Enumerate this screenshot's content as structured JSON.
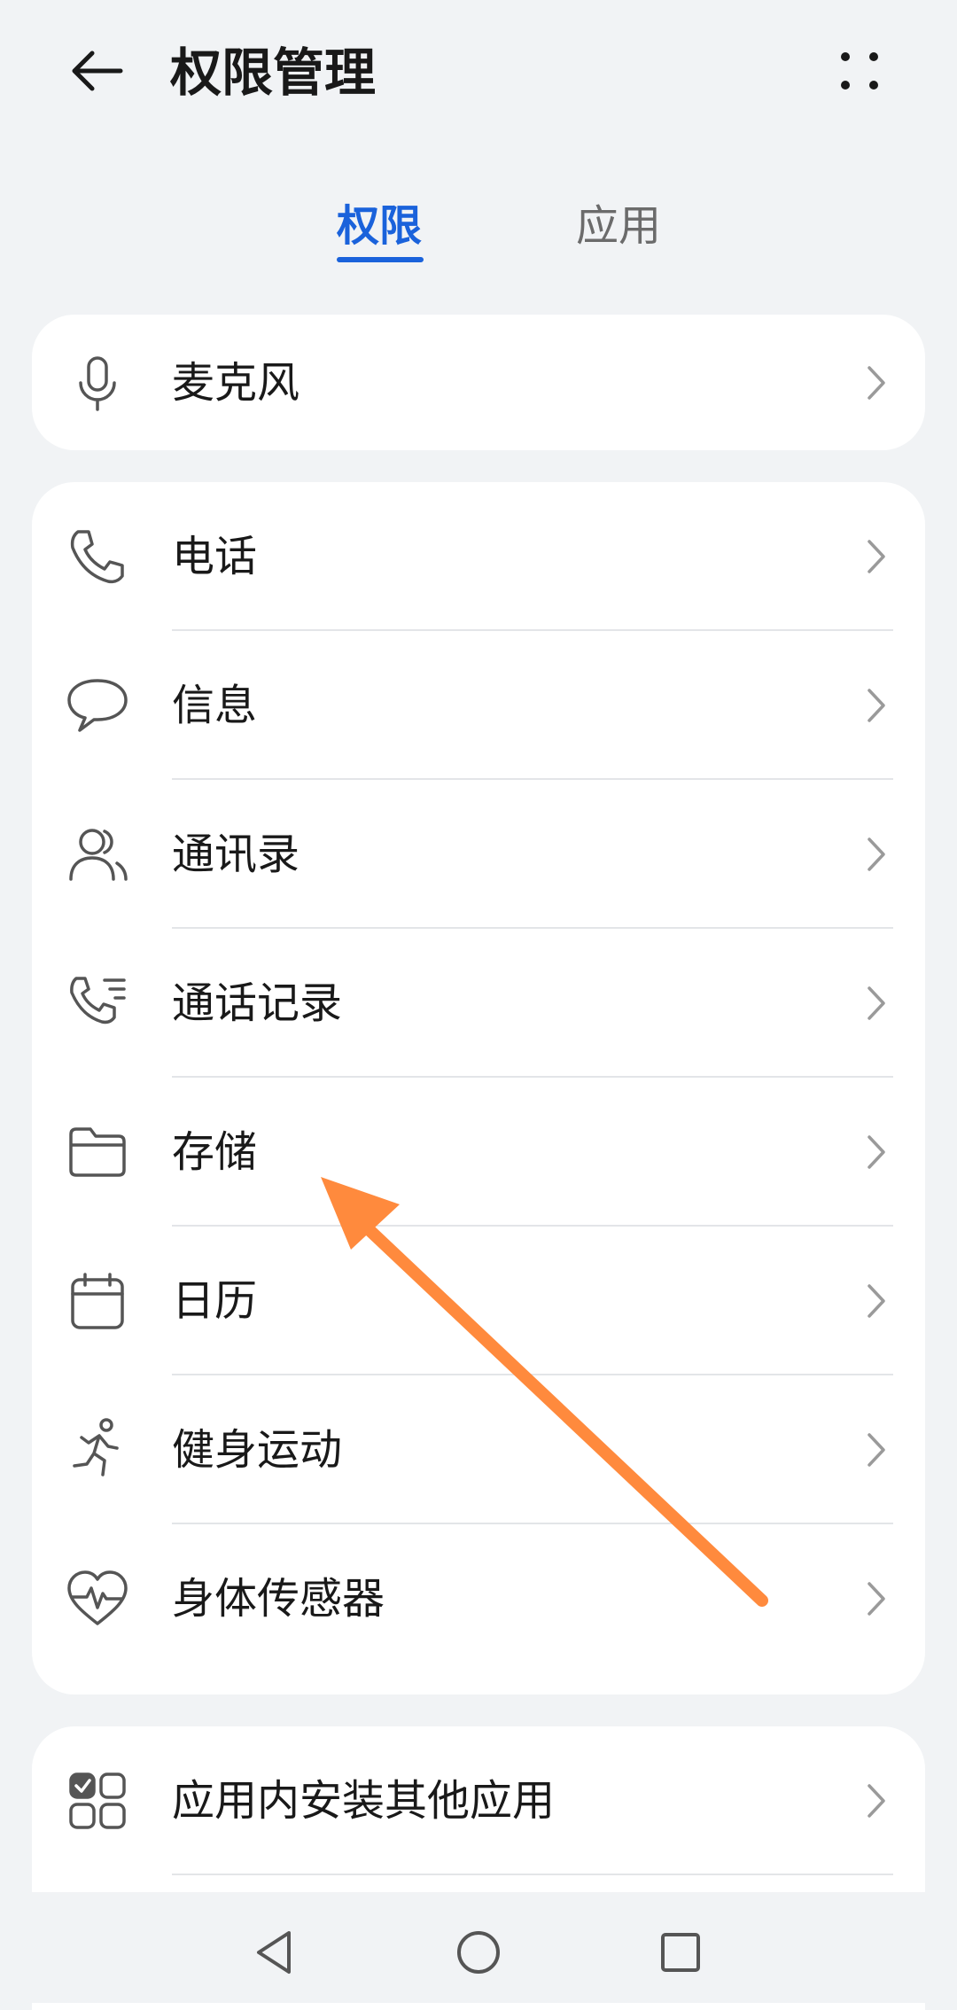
{
  "header": {
    "title": "权限管理",
    "back_icon": "back-arrow-icon",
    "more_icon": "more-dots-icon"
  },
  "tabs": [
    {
      "label": "权限",
      "active": true
    },
    {
      "label": "应用",
      "active": false
    }
  ],
  "colors": {
    "accent": "#1a62db",
    "background": "#f1f3f5",
    "card": "#ffffff",
    "annotation": "#ff8a3d"
  },
  "cards": {
    "first": [
      {
        "label": "麦克风",
        "icon": "microphone-icon"
      }
    ],
    "main": [
      {
        "label": "电话",
        "icon": "phone-icon"
      },
      {
        "label": "信息",
        "icon": "message-icon"
      },
      {
        "label": "通讯录",
        "icon": "contacts-icon"
      },
      {
        "label": "通话记录",
        "icon": "call-log-icon"
      },
      {
        "label": "存储",
        "icon": "folder-icon"
      },
      {
        "label": "日历",
        "icon": "calendar-icon"
      },
      {
        "label": "健身运动",
        "icon": "running-icon"
      },
      {
        "label": "身体传感器",
        "icon": "heart-rate-icon"
      }
    ],
    "last": [
      {
        "label": "应用内安装其他应用",
        "icon": "app-install-icon"
      }
    ]
  },
  "navbar": {
    "back": "nav-back-icon",
    "home": "nav-home-icon",
    "recents": "nav-recents-icon"
  }
}
